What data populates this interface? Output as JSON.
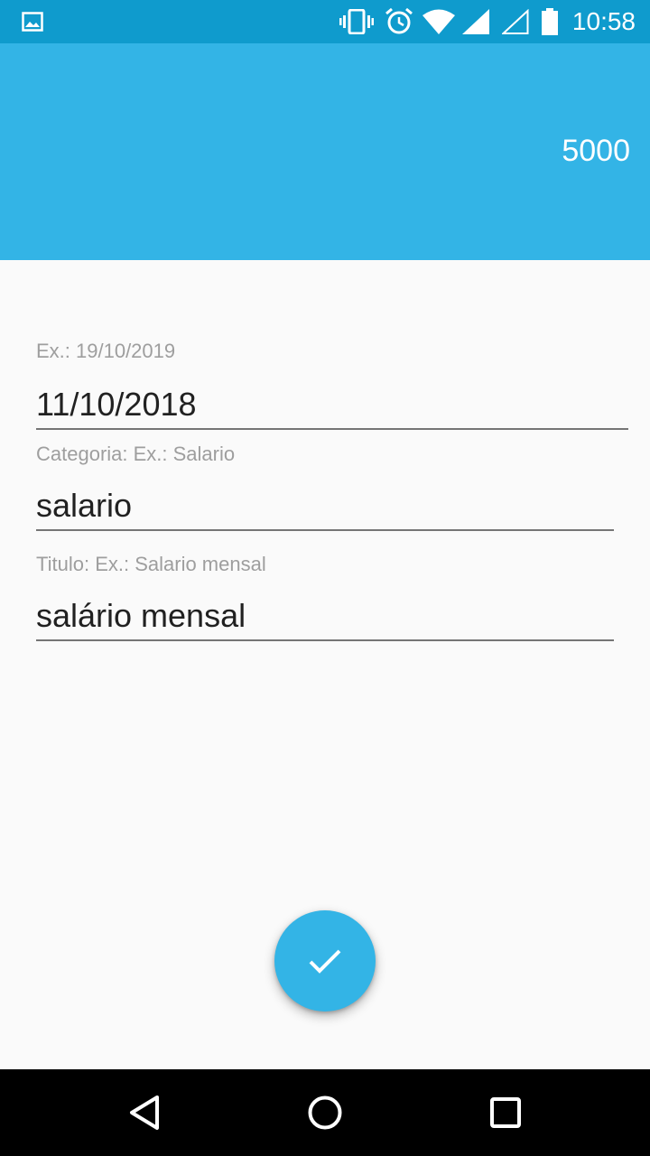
{
  "status_bar": {
    "time": "10:58",
    "icons": [
      "image-icon",
      "vibrate-icon",
      "alarm-icon",
      "wifi-icon",
      "signal-icon",
      "signal-empty-icon",
      "battery-icon"
    ]
  },
  "header": {
    "value": "5000",
    "color": "#33b4e6"
  },
  "form": {
    "date": {
      "label": "Ex.: 19/10/2019",
      "value": "11/10/2018"
    },
    "category": {
      "label": "Categoria: Ex.: Salario",
      "value": "salario"
    },
    "title": {
      "label": "Titulo: Ex.: Salario mensal",
      "value": "salário mensal"
    }
  },
  "fab": {
    "icon": "check-icon",
    "color": "#33b4e6"
  },
  "nav_bar": {
    "icons": [
      "back-icon",
      "home-icon",
      "recents-icon"
    ]
  }
}
